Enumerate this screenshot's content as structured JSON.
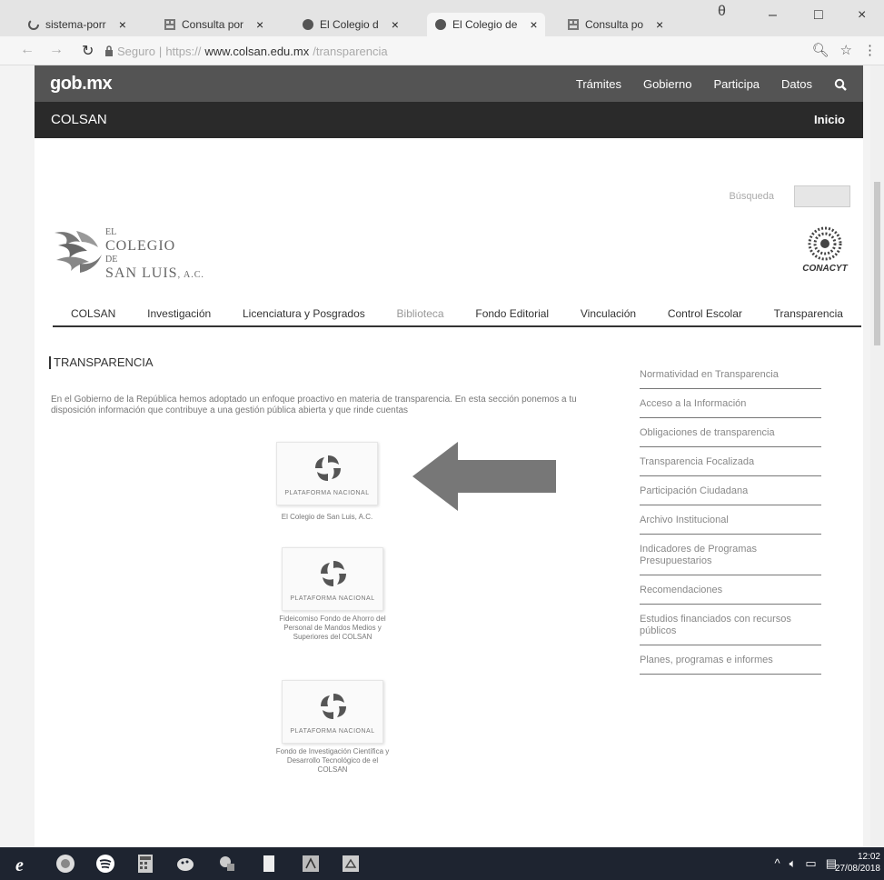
{
  "browser": {
    "tabs": [
      {
        "title": "sistema-porr",
        "close": "×"
      },
      {
        "title": "Consulta por",
        "close": "×"
      },
      {
        "title": "El Colegio d",
        "close": "×"
      },
      {
        "title": "El Colegio de",
        "close": "×"
      },
      {
        "title": "Consulta po",
        "close": "×"
      }
    ],
    "window": {
      "profile": "θ",
      "minimize": "–",
      "maximize": "□",
      "close": "×"
    },
    "address": {
      "secure_label": "Seguro",
      "scheme": "https://",
      "host": "www.colsan.edu.mx",
      "path": "/transparencia"
    }
  },
  "gob_header": {
    "logo": "gob.mx",
    "nav": [
      "Trámites",
      "Gobierno",
      "Participa",
      "Datos"
    ]
  },
  "colsan_bar": {
    "title": "COLSAN",
    "inicio": "Inicio"
  },
  "search": {
    "label": "Búsqueda"
  },
  "logo": {
    "line1": "EL",
    "line2": "COLEGIO",
    "line3": "DE",
    "line4": "SAN LUIS",
    "suffix": ", A.C.",
    "conacyt": "CONACYT"
  },
  "main_nav": [
    "COLSAN",
    "Investigación",
    "Licenciatura y Posgrados",
    "Biblioteca",
    "Fondo Editorial",
    "Vinculación",
    "Control Escolar",
    "Transparencia"
  ],
  "section": {
    "title": "TRANSPARENCIA",
    "intro": "En el Gobierno de la República hemos adoptado un enfoque proactivo en materia de transparencia. En esta sección ponemos a tu disposición información que contribuye a una gestión pública abierta y que rinde cuentas"
  },
  "cards": [
    {
      "label": "PLATAFORMA NACIONAL",
      "caption": "El Colegio de San Luis, A.C."
    },
    {
      "label": "PLATAFORMA NACIONAL",
      "caption": "Fideicomiso Fondo de Ahorro del Personal de Mandos Medios y Superiores del COLSAN"
    },
    {
      "label": "PLATAFORMA NACIONAL",
      "caption": "Fondo de Investigación Científica y Desarrollo Tecnológico de el COLSAN"
    }
  ],
  "sidebar": [
    "Normatividad en Transparencia",
    "Acceso a la Información",
    "Obligaciones de transparencia",
    "Transparencia Focalizada",
    "Participación Ciudadana",
    "Archivo Institucional",
    "Indicadores de Programas Presupuestarios",
    "Recomendaciones",
    "Estudios financiados con recursos públicos",
    "Planes, programas e informes"
  ],
  "taskbar": {
    "time": "12:02",
    "date": "27/08/2018"
  },
  "colors": {
    "gob_bar": "#545454",
    "colsan_bar": "#2a2a2a",
    "arrow": "#777777",
    "taskbar": "#1e2430"
  }
}
